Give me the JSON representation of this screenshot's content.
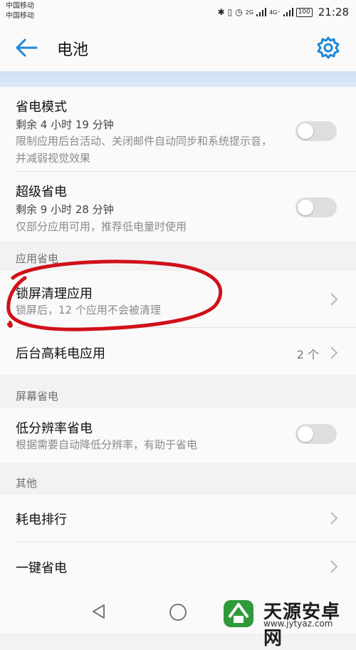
{
  "status": {
    "carrier1": "中国移动",
    "carrier2": "中国移动",
    "net1": "2G",
    "net2": "4G⁺",
    "battery": "100",
    "time": "21:28"
  },
  "header": {
    "title": "电池"
  },
  "items": {
    "power_saving": {
      "title": "省电模式",
      "remaining": "剩余 4 小时 19 分钟",
      "desc": "限制应用后台活动、关闭邮件自动同步和系统提示音，并减弱视觉效果",
      "toggle_on": false
    },
    "ultra_saving": {
      "title": "超级省电",
      "remaining": "剩余 9 小时 28 分钟",
      "desc": "仅部分应用可用，推荐低电量时使用",
      "toggle_on": false
    },
    "lock_clean": {
      "title": "锁屏清理应用",
      "desc": "锁屏后，12 个应用不会被清理"
    },
    "high_drain": {
      "title": "后台高耗电应用",
      "count": "2 个"
    },
    "low_res": {
      "title": "低分辨率省电",
      "desc": "根据需要自动降低分辨率，有助于省电",
      "toggle_on": false
    },
    "ranking": {
      "title": "耗电排行"
    },
    "one_key": {
      "title": "一键省电"
    }
  },
  "sections": {
    "app_saving": "应用省电",
    "screen_saving": "屏幕省电",
    "other": "其他"
  },
  "watermark": {
    "name": "天源安卓网",
    "url": "www.jytyaz.com"
  },
  "colors": {
    "accent": "#1e88d8",
    "annotation": "#d0101a"
  }
}
